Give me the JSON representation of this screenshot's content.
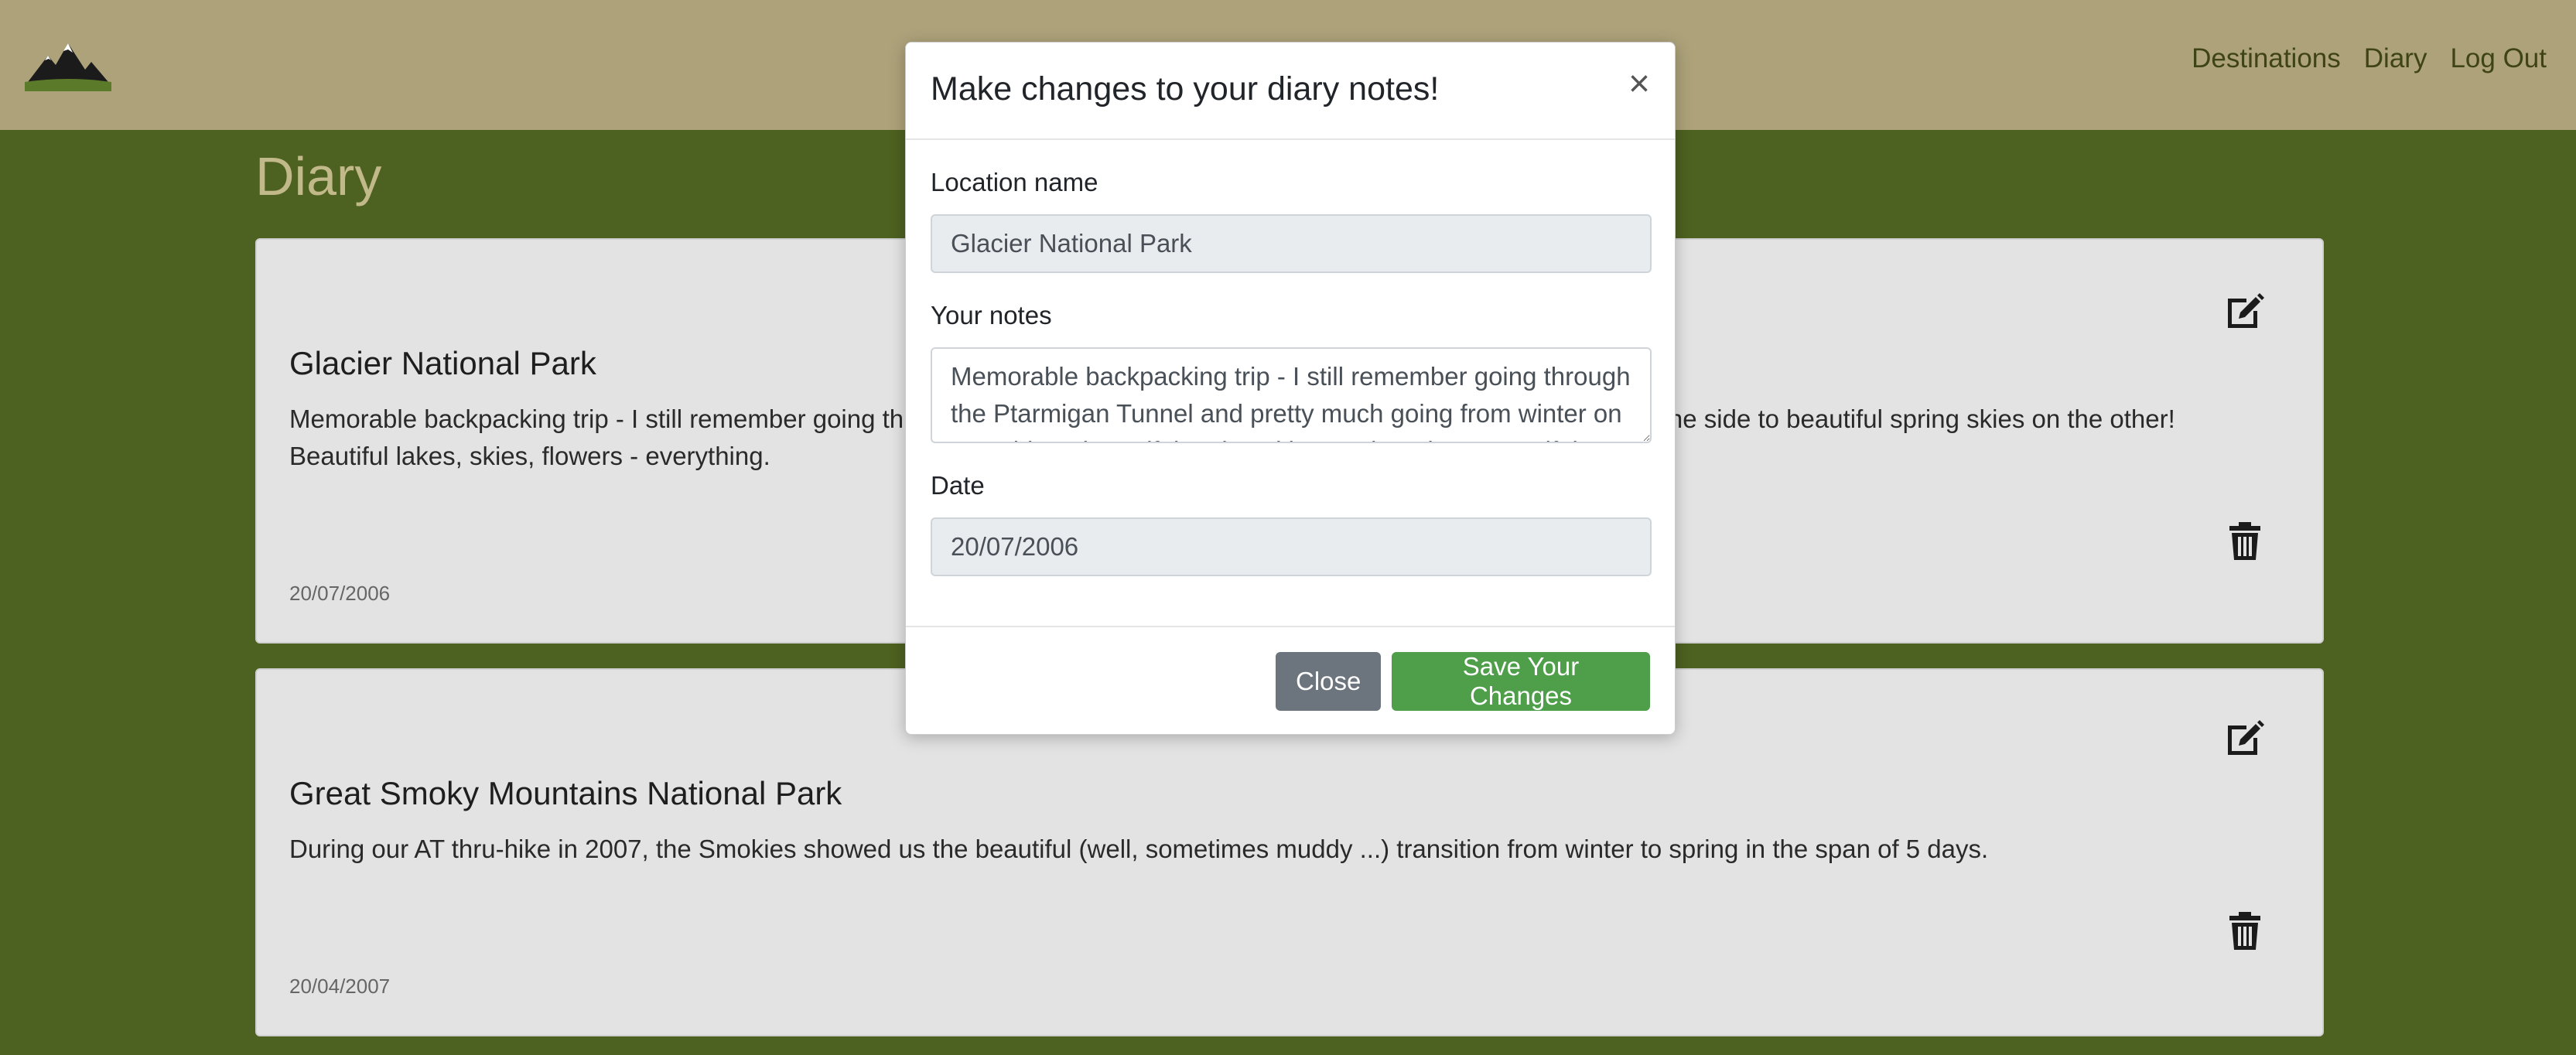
{
  "nav": {
    "links": [
      "Destinations",
      "Diary",
      "Log Out"
    ]
  },
  "page": {
    "title": "Diary"
  },
  "entries": [
    {
      "title": "Glacier National Park",
      "notes": "Memorable backpacking trip - I still remember going through the Ptarmigan Tunnel and pretty much going from winter on one side to beautiful spring skies on the other! Beautiful lakes, skies, flowers - everything.",
      "date": "20/07/2006"
    },
    {
      "title": "Great Smoky Mountains National Park",
      "notes": "During our AT thru-hike in 2007, the Smokies showed us the beautiful (well, sometimes muddy ...) transition from winter to spring in the span of 5 days.",
      "date": "20/04/2007"
    }
  ],
  "modal": {
    "title": "Make changes to your diary notes!",
    "close_symbol": "×",
    "location_label": "Location name",
    "location_value": "Glacier National Park",
    "notes_label": "Your notes",
    "notes_value": "Memorable backpacking trip - I still remember going through the Ptarmigan Tunnel and pretty much going from winter on one side to beautiful spring skies on the other! Beautiful lakes, skies, flowers - everything.",
    "date_label": "Date",
    "date_value": "20/07/2006",
    "close_button": "Close",
    "save_button": "Save Your Changes"
  },
  "colors": {
    "navbar": "#ada27a",
    "background": "#4d6120",
    "save_button": "#4e9e4a",
    "close_button": "#6c757d"
  },
  "icons": [
    "mountain-logo-icon",
    "edit-icon",
    "trash-icon",
    "close-icon"
  ]
}
